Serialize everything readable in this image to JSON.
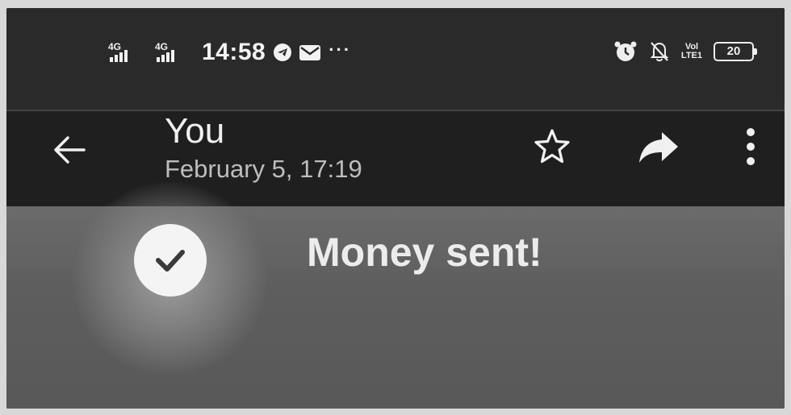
{
  "status_bar": {
    "network_1": "4G",
    "network_2": "4G",
    "time": "14:58",
    "icons_left": [
      "telegram-icon",
      "mail-icon",
      "more-dots"
    ],
    "more_dots": "···",
    "icons_right": [
      "alarm-icon",
      "bell-off-icon",
      "volte-icon",
      "battery-icon"
    ],
    "volte_line1": "Vol",
    "volte_line2": "LTE1",
    "battery_level": "20"
  },
  "app_bar": {
    "title": "You",
    "subtitle": "February 5, 17:19",
    "actions": [
      "star-icon",
      "share-icon",
      "more-vert-icon"
    ]
  },
  "content": {
    "status_icon": "check-icon",
    "message": "Money sent!"
  },
  "colors": {
    "status_bar_bg": "#2a2a2a",
    "app_bar_bg": "#1f1f1f",
    "content_bg": "#5e5e5e",
    "text_primary": "#f0f0f0",
    "text_secondary": "#bdbdbd"
  }
}
